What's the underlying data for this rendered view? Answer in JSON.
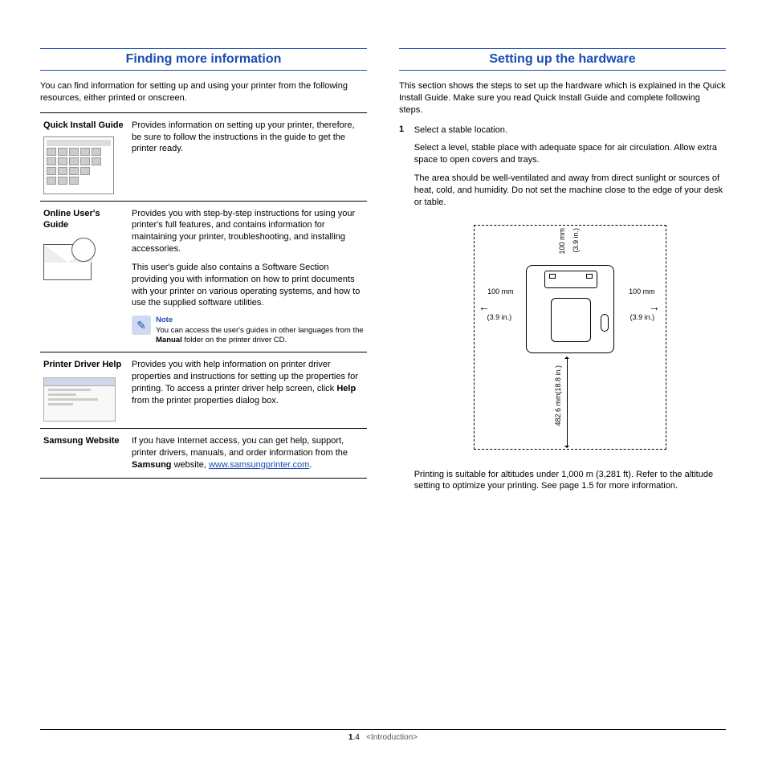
{
  "left": {
    "title": "Finding more information",
    "intro": "You can find information for setting up and using your printer from the following resources, either printed or onscreen.",
    "rows": [
      {
        "label": "Quick Install Guide",
        "desc": "Provides information on setting up your printer, therefore, be sure to follow the instructions in the guide to get the printer ready."
      },
      {
        "label": "Online User's Guide",
        "desc": "Provides you with step-by-step instructions for using your printer's full features, and contains information for maintaining your printer, troubleshooting, and installing accessories.",
        "desc2": "This user's guide also contains a Software Section providing you with information on how to print documents with your printer on various operating systems, and how to use the supplied software utilities.",
        "note_title": "Note",
        "note_pre": "You can access the user's guides in other languages from the ",
        "note_bold": "Manual",
        "note_post": " folder on the printer driver CD."
      },
      {
        "label": "Printer Driver Help",
        "desc_pre": "Provides you with help information on printer driver properties and instructions for setting up the properties for printing. To access a printer driver help screen, click ",
        "desc_bold": "Help",
        "desc_post": " from the printer properties dialog box."
      },
      {
        "label": "Samsung Website",
        "desc_pre": "If you have Internet access, you can get help, support, printer drivers, manuals, and order information from the ",
        "desc_bold": "Samsung",
        "desc_post": " website, ",
        "link": "www.samsungprinter.com",
        "period": "."
      }
    ]
  },
  "right": {
    "title": "Setting up the hardware",
    "intro": "This section shows the steps to set up the hardware which is explained in the Quick Install Guide. Make sure you read Quick Install Guide and complete following steps.",
    "step_num": "1",
    "step_title": "Select a stable location.",
    "step_p1": "Select a level, stable place with adequate space for air circulation. Allow extra space to open covers and trays.",
    "step_p2": "The area should be well-ventilated and away from direct sunlight or sources of heat, cold, and humidity. Do not set the machine close to the edge of your desk or table.",
    "dims": {
      "top_mm": "100 mm",
      "top_in": "(3.9 in.)",
      "left_mm": "100 mm",
      "left_in": "(3.9 in.)",
      "right_mm": "100 mm",
      "right_in": "(3.9 in.)",
      "front": "482.6 mm(18.8 in.)"
    },
    "step_p3": "Printing is suitable for altitudes under 1,000 m (3,281 ft). Refer to the altitude setting to optimize your printing. See page 1.5 for more information."
  },
  "footer": {
    "chapter": "1",
    "page": ".4",
    "section": "<Introduction>"
  }
}
